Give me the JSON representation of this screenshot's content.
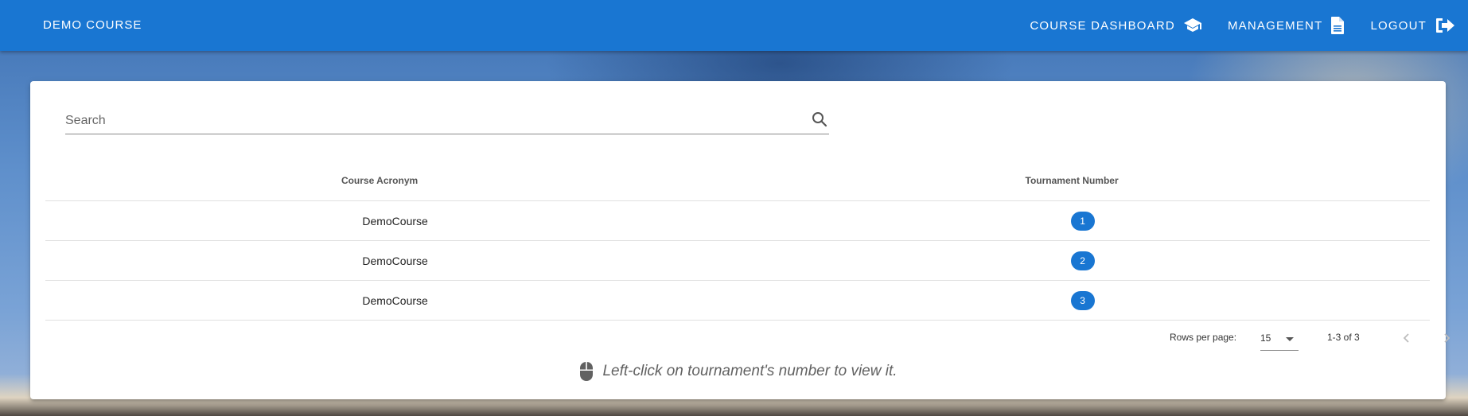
{
  "app_bar": {
    "title": "DEMO COURSE",
    "nav": [
      {
        "label": "COURSE DASHBOARD",
        "icon": "school-icon"
      },
      {
        "label": "MANAGEMENT",
        "icon": "document-icon"
      },
      {
        "label": "LOGOUT",
        "icon": "logout-icon"
      }
    ],
    "color": "#1976d2"
  },
  "search": {
    "placeholder": "Search",
    "value": ""
  },
  "table": {
    "headers": [
      "Course Acronym",
      "Tournament Number"
    ],
    "rows": [
      {
        "acronym": "DemoCourse",
        "number": "1"
      },
      {
        "acronym": "DemoCourse",
        "number": "2"
      },
      {
        "acronym": "DemoCourse",
        "number": "3"
      }
    ]
  },
  "pagination": {
    "rows_per_page_label": "Rows per page:",
    "rows_per_page_value": "15",
    "range_text": "1-3 of 3"
  },
  "hint": {
    "text": "Left-click on tournament's number to view it.",
    "icon": "mouse-icon"
  }
}
